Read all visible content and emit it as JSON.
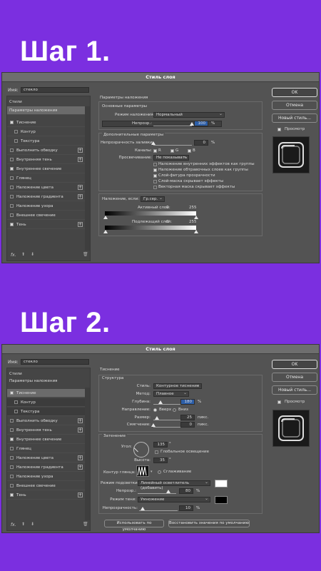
{
  "steps": {
    "step1": "Шаг 1.",
    "step2": "Шаг 2."
  },
  "dialog": {
    "title": "Стиль слоя",
    "name_label": "Имя:",
    "name_value": "стекло",
    "buttons": {
      "ok": "OK",
      "cancel": "Отмена",
      "new_style": "Новый стиль...",
      "preview": "Просмотр"
    },
    "styles_header": "Стили",
    "blending_options": "Параметры наложения",
    "fx_label": "fx.",
    "style_items": [
      {
        "label": "Тиснение",
        "checked": true,
        "plus": false
      },
      {
        "label": "Контур",
        "checked": false,
        "plus": false
      },
      {
        "label": "Текстура",
        "checked": false,
        "plus": false
      },
      {
        "label": "Выполнить обводку",
        "checked": false,
        "plus": true
      },
      {
        "label": "Внутренняя тень",
        "checked": false,
        "plus": true
      },
      {
        "label": "Внутреннее свечение",
        "checked": true,
        "plus": false
      },
      {
        "label": "Глянец",
        "checked": false,
        "plus": false
      },
      {
        "label": "Наложение цвета",
        "checked": false,
        "plus": true
      },
      {
        "label": "Наложение градиента",
        "checked": false,
        "plus": true
      },
      {
        "label": "Наложение узора",
        "checked": false,
        "plus": false
      },
      {
        "label": "Внешнее свечение",
        "checked": false,
        "plus": false
      },
      {
        "label": "Тень",
        "checked": true,
        "plus": true
      }
    ]
  },
  "panel1": {
    "title": "Параметры наложения",
    "basic_title": "Основные параметры",
    "blend_mode_label": "Режим наложения:",
    "blend_mode_value": "Нормальный",
    "opacity_label": "Непрозр.:",
    "opacity_value": "100",
    "percent": "%",
    "advanced_title": "Дополнительные параметры",
    "fill_opacity_label": "Непрозрачность заливки:",
    "fill_opacity_value": "0",
    "channels_label": "Каналы:",
    "channels": [
      "R",
      "G",
      "B"
    ],
    "knockout_label": "Просвечивание:",
    "knockout_value": "Не показывать",
    "options": [
      {
        "label": "Наложение внутренних эффектов как группы",
        "checked": false
      },
      {
        "label": "Наложение обтравочных слоев как группы",
        "checked": true
      },
      {
        "label": "Слой-фигура прозрачности",
        "checked": true
      },
      {
        "label": "Слой-маска скрывает эффекты",
        "checked": false
      },
      {
        "label": "Векторная маска скрывает эффекты",
        "checked": false
      }
    ],
    "blend_if_label": "Наложение, если:",
    "blend_if_value": "Гр.сер.",
    "this_layer_label": "Активный слой:",
    "underlying_label": "Подлежащий слой:",
    "range_min": "0",
    "range_max": "255",
    "opacity_fraction": 1.0,
    "fill_opacity_fraction": 0.0
  },
  "panel2": {
    "title": "Тиснение",
    "structure_title": "Структура",
    "style_label": "Стиль:",
    "style_value": "Контурное тиснение",
    "technique_label": "Метод:",
    "technique_value": "Плавное",
    "depth_label": "Глубина:",
    "depth_value": "180",
    "direction_label": "Направление:",
    "direction_up": "Вверх",
    "direction_down": "Вниз",
    "size_label": "Размер:",
    "size_value": "25",
    "soften_label": "Смягчение:",
    "soften_value": "0",
    "px": "пикс.",
    "percent": "%",
    "shading_title": "Затенение",
    "angle_label": "Угол:",
    "angle_value": "135",
    "degree": "°",
    "global_light_label": "Глобальное освещение",
    "altitude_label": "Высота:",
    "altitude_value": "35",
    "gloss_contour_label": "Контур глянца:",
    "antialias_label": "Сглаживание",
    "highlight_mode_label": "Режим подсветки:",
    "highlight_mode_value": "Линейный осветлитель (добавить)",
    "highlight_opacity_label": "Непрозр.:",
    "highlight_opacity_value": "80",
    "shadow_mode_label": "Режим тени:",
    "shadow_mode_value": "Умножение",
    "shadow_opacity_label": "Непрозрачность:",
    "shadow_opacity_value": "10",
    "make_default": "Использовать по умолчанию",
    "reset_default": "Восстановить значения по умолчанию",
    "highlight_color": "#ffffff",
    "shadow_color": "#000000",
    "depth_fraction": 0.18,
    "size_fraction": 0.1,
    "soften_fraction": 0.0,
    "highlight_opacity_fraction": 0.8,
    "shadow_opacity_fraction": 0.1
  },
  "colors": {
    "background": "#7b2fe0",
    "dialog": "#535353",
    "highlight": "#2d5fa8"
  }
}
